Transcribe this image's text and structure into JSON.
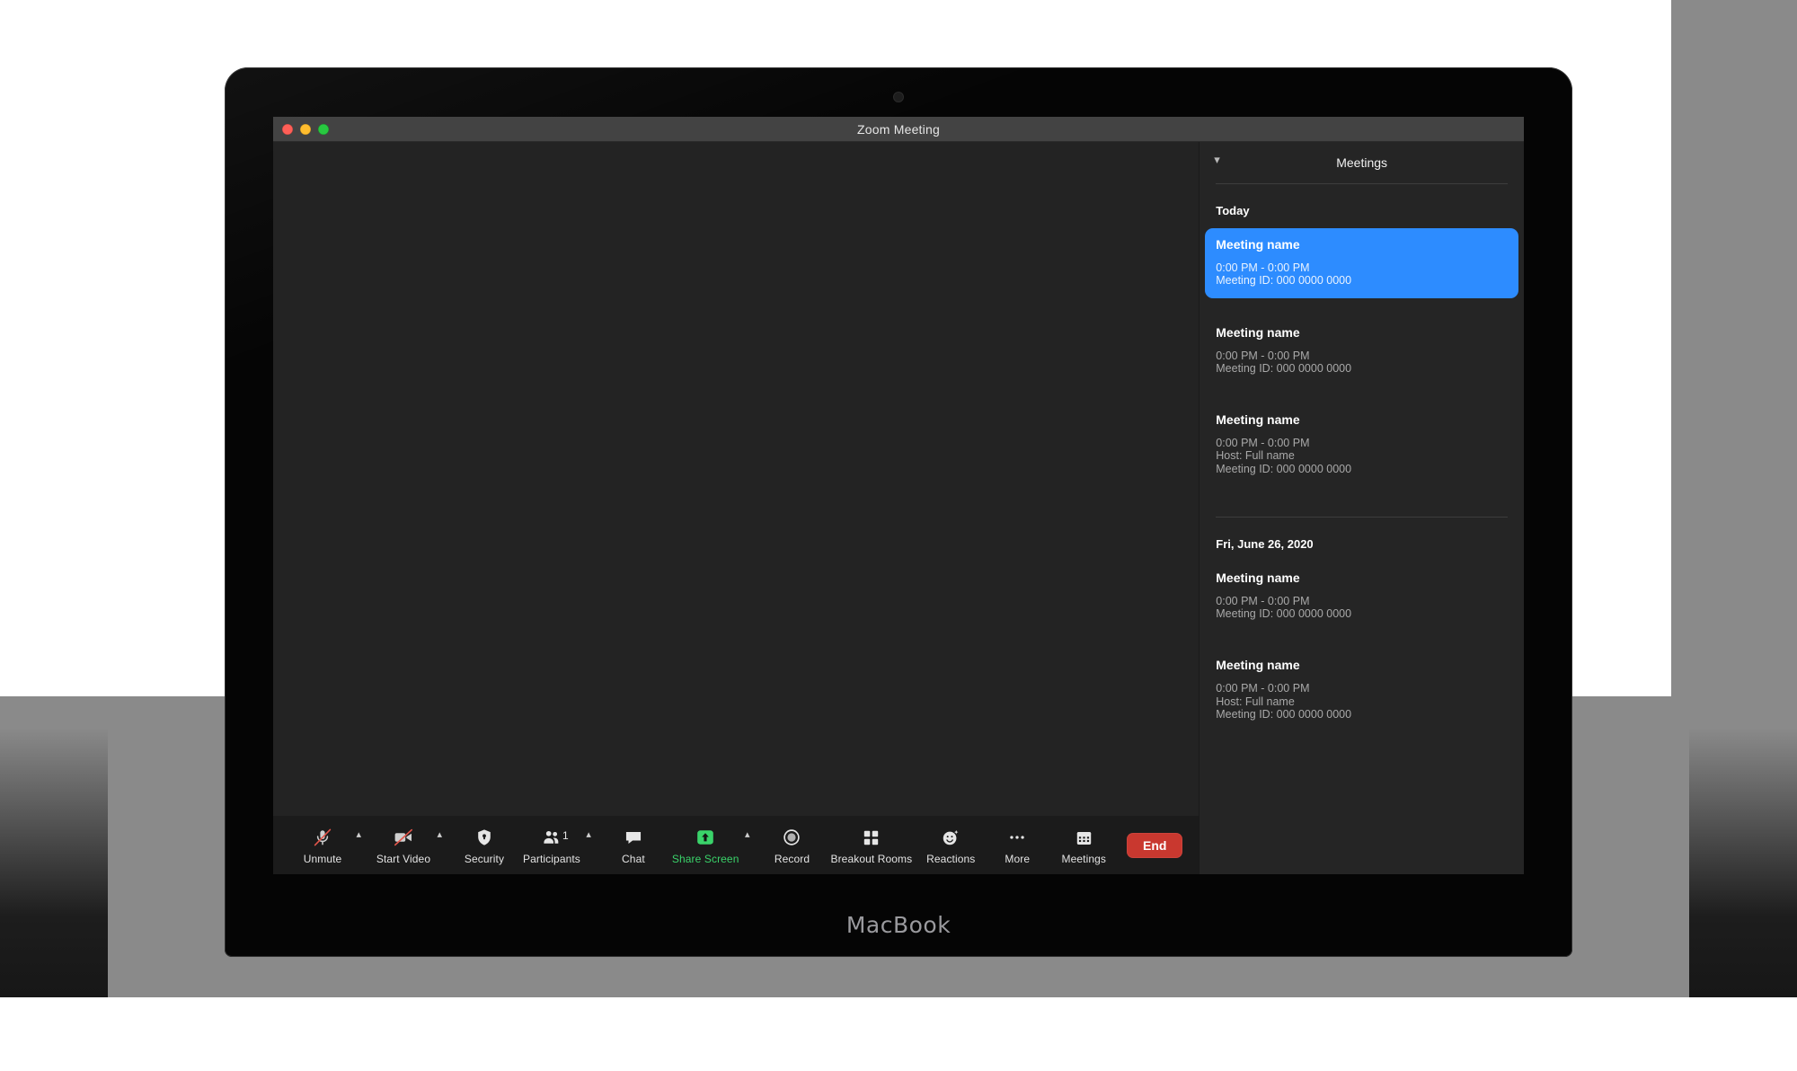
{
  "device": {
    "brand_label": "MacBook",
    "camera_icon": "camera-icon"
  },
  "window": {
    "title": "Zoom Meeting",
    "traffic_lights": {
      "close": "close-window-button",
      "minimize": "minimize-window-button",
      "maximize": "maximize-window-button"
    }
  },
  "toolbar": {
    "items": [
      {
        "id": "unmute",
        "label": "Unmute",
        "icon": "microphone-muted-icon",
        "caret": true,
        "caret_icon": "chevron-up-icon",
        "active": false
      },
      {
        "id": "start-video",
        "label": "Start Video",
        "icon": "video-camera-off-icon",
        "caret": true,
        "caret_icon": "chevron-up-icon",
        "active": false
      },
      {
        "id": "security",
        "label": "Security",
        "icon": "shield-icon",
        "caret": false,
        "active": false
      },
      {
        "id": "participants",
        "label": "Participants",
        "icon": "participants-icon",
        "caret": true,
        "caret_icon": "chevron-up-icon",
        "badge": "1",
        "active": false
      },
      {
        "id": "chat",
        "label": "Chat",
        "icon": "chat-bubble-icon",
        "caret": false,
        "active": false
      },
      {
        "id": "share-screen",
        "label": "Share Screen",
        "icon": "share-screen-icon",
        "caret": true,
        "caret_icon": "chevron-up-icon",
        "active": true
      },
      {
        "id": "record",
        "label": "Record",
        "icon": "record-circle-icon",
        "caret": false,
        "active": false
      },
      {
        "id": "breakout-rooms",
        "label": "Breakout Rooms",
        "icon": "breakout-rooms-grid-icon",
        "caret": false,
        "active": false
      },
      {
        "id": "reactions",
        "label": "Reactions",
        "icon": "reactions-smiley-icon",
        "caret": false,
        "active": false
      },
      {
        "id": "more",
        "label": "More",
        "icon": "more-ellipsis-icon",
        "caret": false,
        "active": false
      },
      {
        "id": "meetings",
        "label": "Meetings",
        "icon": "calendar-icon",
        "caret": false,
        "active": false
      }
    ],
    "end_button": {
      "label": "End",
      "color": "#c9382f"
    },
    "share_active_color": "#3ad36a"
  },
  "panel": {
    "title": "Meetings",
    "collapse_icon": "chevron-down-icon",
    "accent_color": "#2d8cff",
    "groups": [
      {
        "day_label": "Today",
        "meetings": [
          {
            "name": "Meeting name",
            "time": "0:00 PM - 0:00 PM",
            "host": null,
            "meeting_id": "Meeting ID: 000 0000 0000",
            "selected": true
          },
          {
            "name": "Meeting name",
            "time": "0:00 PM - 0:00 PM",
            "host": null,
            "meeting_id": "Meeting ID: 000 0000 0000",
            "selected": false
          },
          {
            "name": "Meeting name",
            "time": "0:00 PM - 0:00 PM",
            "host": "Host: Full name",
            "meeting_id": "Meeting ID: 000 0000 0000",
            "selected": false
          }
        ]
      },
      {
        "day_label": "Fri, June 26, 2020",
        "meetings": [
          {
            "name": "Meeting name",
            "time": "0:00 PM - 0:00 PM",
            "host": null,
            "meeting_id": "Meeting ID: 000 0000 0000",
            "selected": false
          },
          {
            "name": "Meeting name",
            "time": "0:00 PM - 0:00 PM",
            "host": "Host: Full name",
            "meeting_id": "Meeting ID: 000 0000 0000",
            "selected": false
          }
        ]
      }
    ]
  }
}
